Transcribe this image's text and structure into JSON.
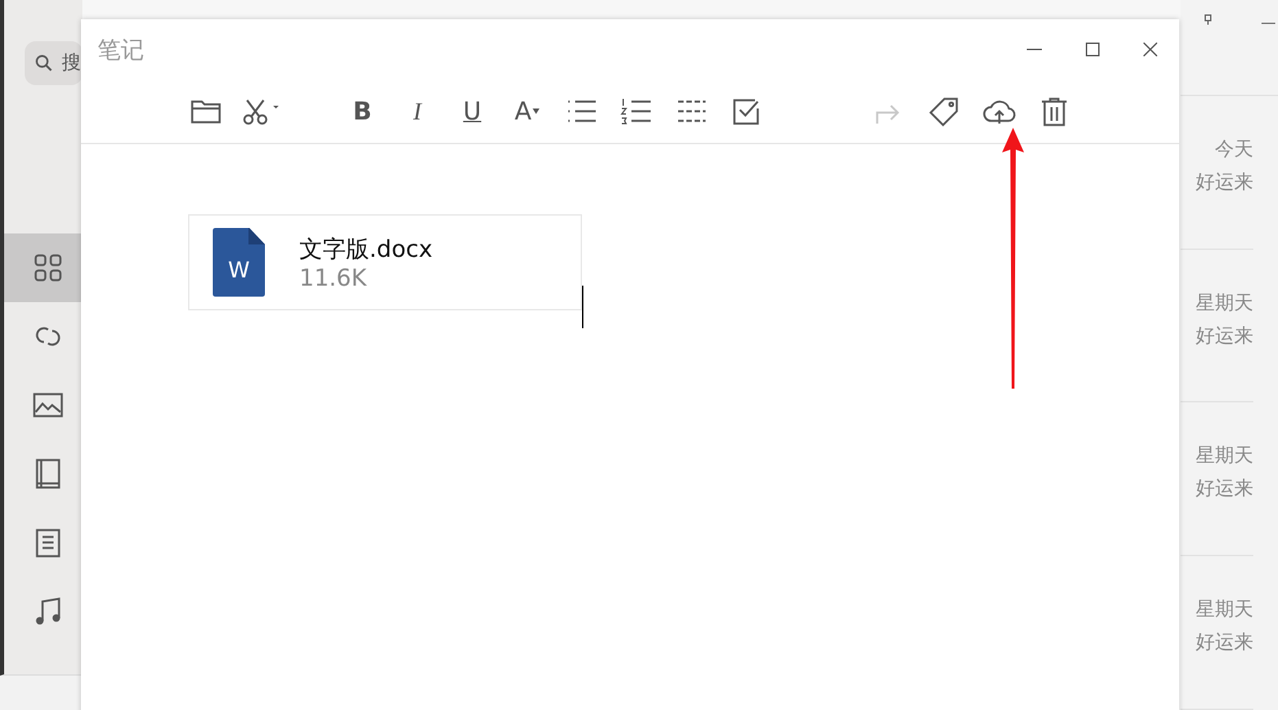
{
  "app": {
    "search": {
      "placeholder": "搜"
    },
    "sidebar": {
      "items": [
        {
          "kind": "grid",
          "selected": true
        },
        {
          "kind": "link",
          "selected": false
        },
        {
          "kind": "image",
          "selected": false
        },
        {
          "kind": "book",
          "selected": false
        },
        {
          "kind": "doc",
          "selected": false
        },
        {
          "kind": "music",
          "selected": false
        }
      ]
    },
    "notes": [
      {
        "date": "今天",
        "title": "好运来"
      },
      {
        "date": "星期天",
        "title": "好运来"
      },
      {
        "date": "星期天",
        "title": "好运来"
      },
      {
        "date": "星期天",
        "title": "好运来"
      }
    ]
  },
  "window": {
    "title": "笔记",
    "toolbar": [
      {
        "kind": "folder",
        "disabled": false
      },
      {
        "kind": "scissors",
        "disabled": false
      },
      {
        "kind": "gap"
      },
      {
        "kind": "bold",
        "label": "B",
        "disabled": false
      },
      {
        "kind": "italic",
        "label": "I",
        "disabled": false
      },
      {
        "kind": "underline",
        "label": "U",
        "disabled": false
      },
      {
        "kind": "font",
        "label": "A",
        "disabled": false
      },
      {
        "kind": "bullets",
        "disabled": false
      },
      {
        "kind": "numbers",
        "disabled": false
      },
      {
        "kind": "divider",
        "disabled": false
      },
      {
        "kind": "checkbox",
        "disabled": false
      },
      {
        "kind": "spacer"
      },
      {
        "kind": "share",
        "disabled": true
      },
      {
        "kind": "tag",
        "disabled": false
      },
      {
        "kind": "upload",
        "disabled": false
      },
      {
        "kind": "trash",
        "disabled": false
      }
    ],
    "attachment": {
      "icon_letter": "W",
      "name": "文字版.docx",
      "size": "11.6K"
    }
  },
  "annotation": {
    "kind": "arrow"
  }
}
